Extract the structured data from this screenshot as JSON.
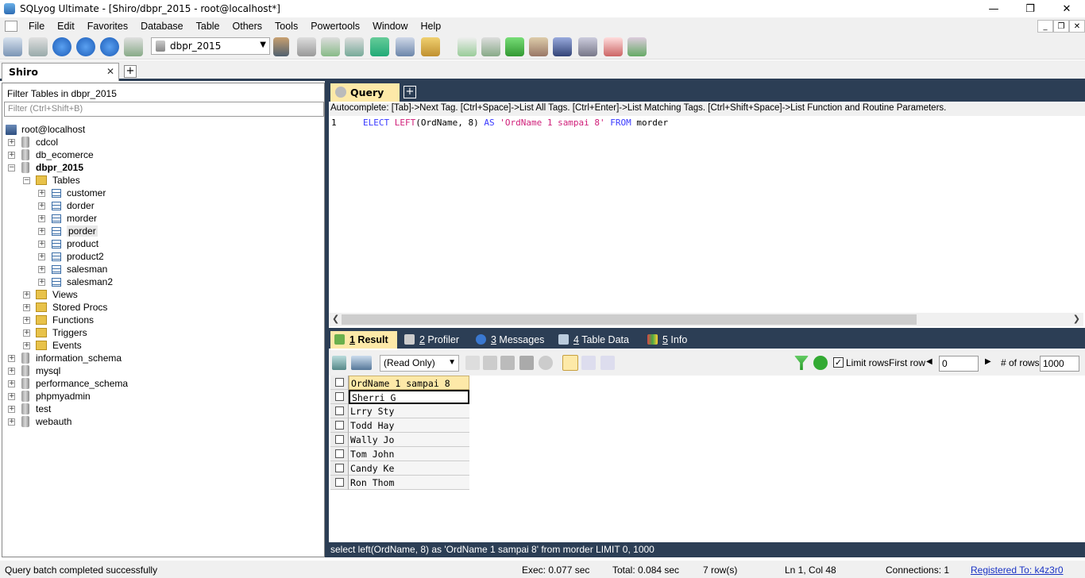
{
  "window": {
    "title": "SQLyog Ultimate - [Shiro/dbpr_2015 - root@localhost*]"
  },
  "menu": [
    "File",
    "Edit",
    "Favorites",
    "Database",
    "Table",
    "Others",
    "Tools",
    "Powertools",
    "Window",
    "Help"
  ],
  "toolbar": {
    "database_selected": "dbpr_2015"
  },
  "connection_tab": {
    "label": "Shiro"
  },
  "object_browser": {
    "filter_label": "Filter Tables in dbpr_2015",
    "filter_placeholder": "Filter (Ctrl+Shift+B)",
    "server": "root@localhost",
    "databases_before": [
      "cdcol",
      "db_ecomerce"
    ],
    "active_db": "dbpr_2015",
    "tables_folder": "Tables",
    "tables": [
      "customer",
      "dorder",
      "morder",
      "porder",
      "product",
      "product2",
      "salesman",
      "salesman2"
    ],
    "folders": [
      "Views",
      "Stored Procs",
      "Functions",
      "Triggers",
      "Events"
    ],
    "databases_after": [
      "information_schema",
      "mysql",
      "performance_schema",
      "phpmyadmin",
      "test",
      "webauth"
    ]
  },
  "query_tab": {
    "label": "Query"
  },
  "autocomplete_hint": "Autocomplete: [Tab]->Next Tag. [Ctrl+Space]->List All Tags. [Ctrl+Enter]->List Matching Tags. [Ctrl+Shift+Space]->List Function and Routine Parameters.",
  "editor": {
    "line_number": "1",
    "tokens": {
      "kw1": "ELECT",
      "fn": "LEFT",
      "args": "(OrdName, 8) ",
      "kw2": "AS",
      "alias": "'OrdName 1 sampai 8'",
      "kw3": "FROM",
      "table": "morder"
    }
  },
  "result_tabs": [
    {
      "num": "1",
      "label": " Result"
    },
    {
      "num": "2",
      "label": " Profiler"
    },
    {
      "num": "3",
      "label": " Messages"
    },
    {
      "num": "4",
      "label": " Table Data"
    },
    {
      "num": "5",
      "label": " Info"
    }
  ],
  "result_toolbar": {
    "mode": "(Read Only)",
    "limit_rows_label": "Limit rows",
    "limit_rows_checked": true,
    "first_row_label": "First row",
    "first_row_value": "0",
    "num_rows_label": "# of rows",
    "num_rows_value": "1000"
  },
  "result_grid": {
    "column": "OrdName 1 sampai 8",
    "rows": [
      "Sherri G",
      "Lrry Sty",
      "Todd Hay",
      "Wally Jo",
      "Tom John",
      "Candy Ke",
      "Ron Thom"
    ]
  },
  "executed_sql": "select left(OrdName, 8) as 'OrdName 1 sampai 8' from morder LIMIT 0, 1000",
  "status": {
    "message": "Query batch completed successfully",
    "exec": "Exec: 0.077 sec",
    "total": "Total: 0.084 sec",
    "rows": "7 row(s)",
    "position": "Ln 1, Col 48",
    "connections": "Connections: 1",
    "registered": "Registered To: k4z3r0"
  },
  "colors": {
    "dark_panel": "#2c3e55",
    "active_tab": "#fde9a8",
    "keyword": "#3a3aff",
    "string": "#d0207a"
  }
}
